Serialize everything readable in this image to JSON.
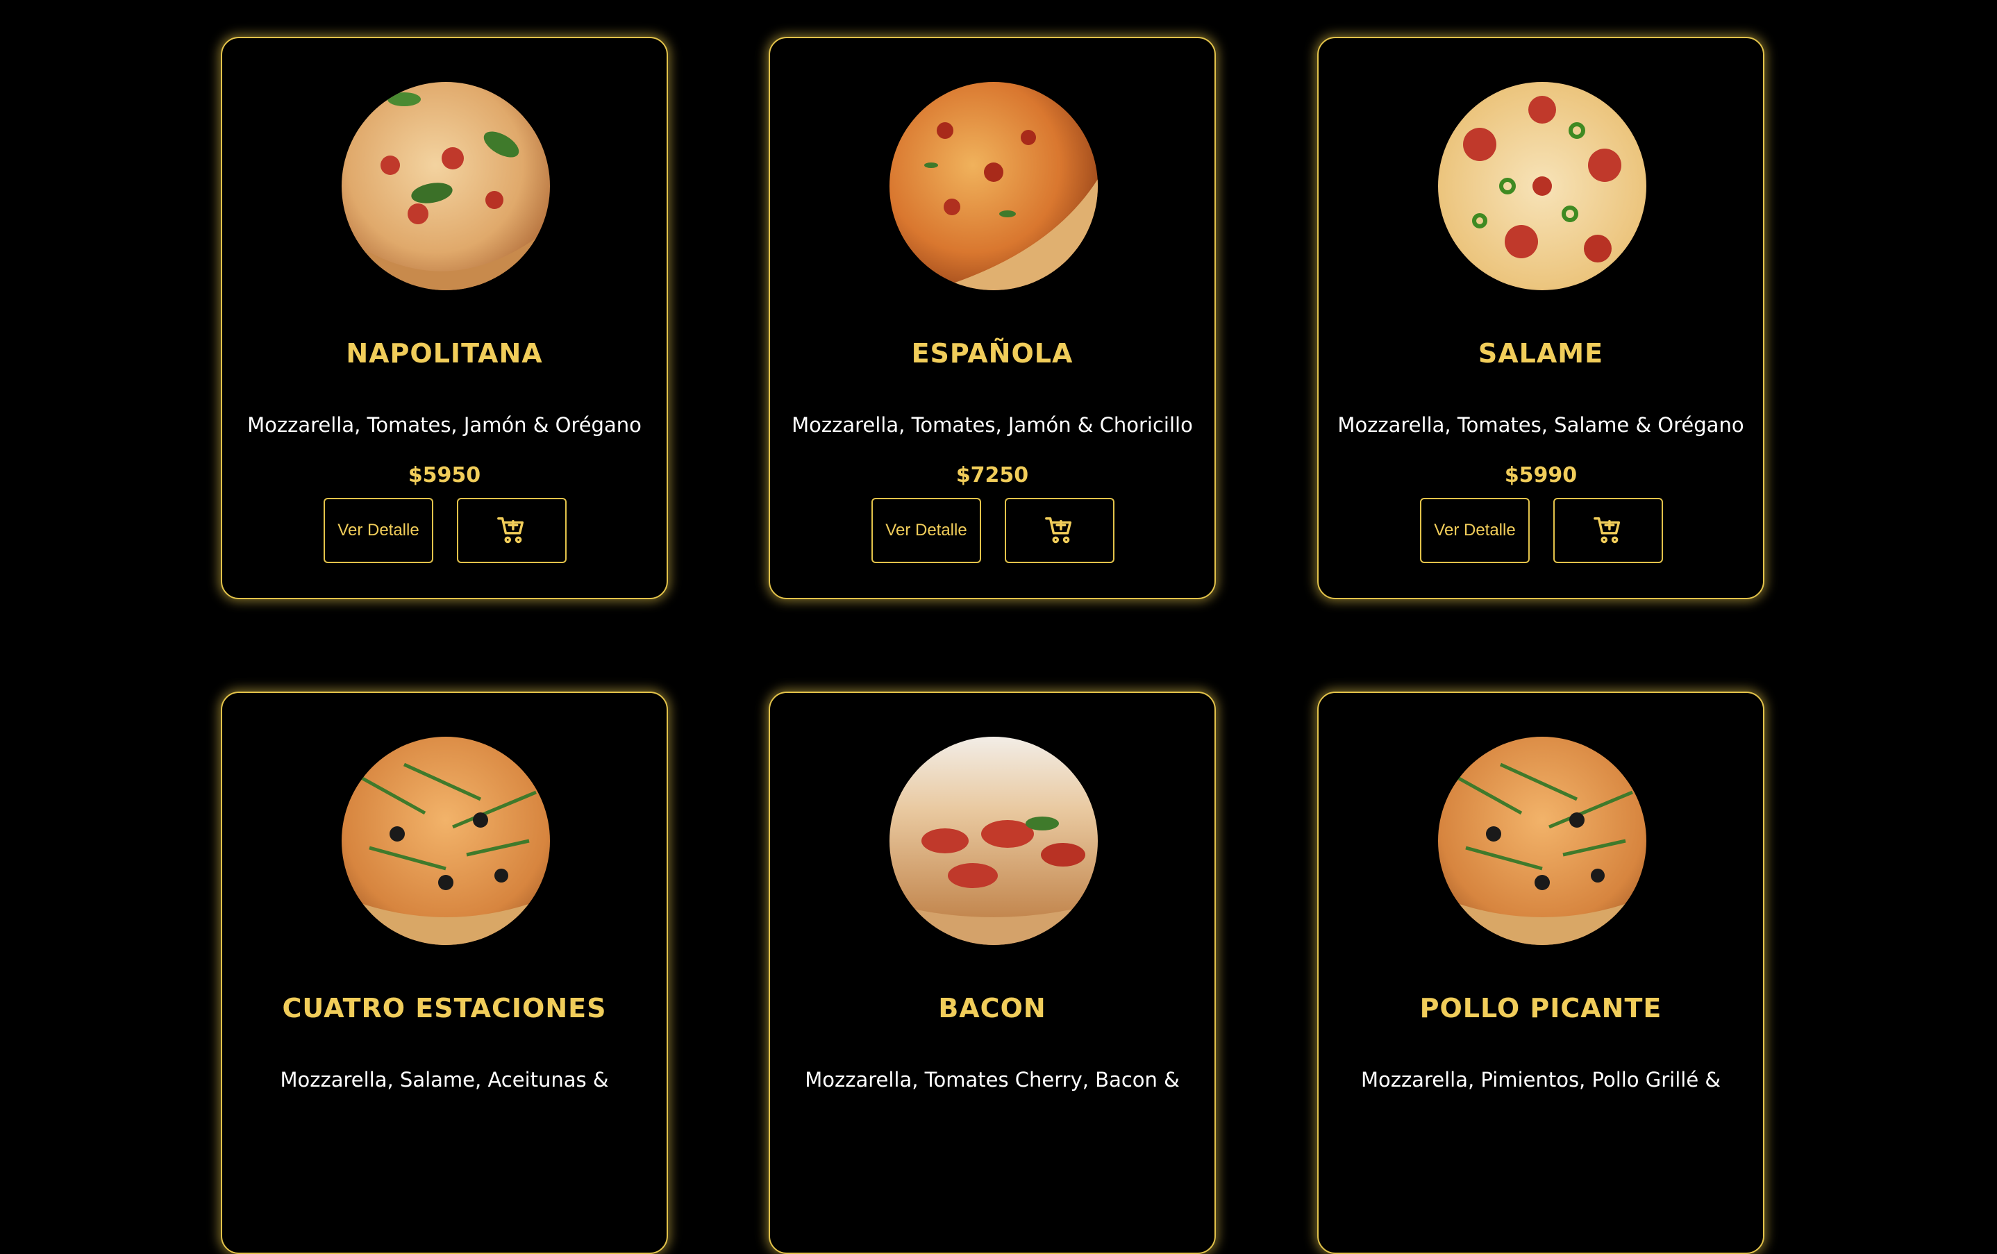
{
  "products": [
    {
      "name": "NAPOLITANA",
      "description": "Mozzarella, Tomates, Jamón & Orégano",
      "price": "$5950",
      "detail_label": "Ver Detalle"
    },
    {
      "name": "ESPAÑOLA",
      "description": "Mozzarella, Tomates, Jamón & Choricillo",
      "price": "$7250",
      "detail_label": "Ver Detalle"
    },
    {
      "name": "SALAME",
      "description": "Mozzarella, Tomates, Salame & Orégano",
      "price": "$5990",
      "detail_label": "Ver Detalle"
    },
    {
      "name": "CUATRO ESTACIONES",
      "description": "Mozzarella, Salame, Aceitunas &",
      "price": "",
      "detail_label": ""
    },
    {
      "name": "BACON",
      "description": "Mozzarella, Tomates Cherry, Bacon &",
      "price": "",
      "detail_label": ""
    },
    {
      "name": "POLLO PICANTE",
      "description": "Mozzarella, Pimientos, Pollo Grillé &",
      "price": "",
      "detail_label": ""
    }
  ],
  "icons": {
    "cart": "add-to-cart-icon",
    "pizza": "pizza-photo"
  },
  "colors": {
    "background": "#000000",
    "accent": "#f1cd5a",
    "border": "#e2c24a",
    "text": "#ffffff"
  }
}
